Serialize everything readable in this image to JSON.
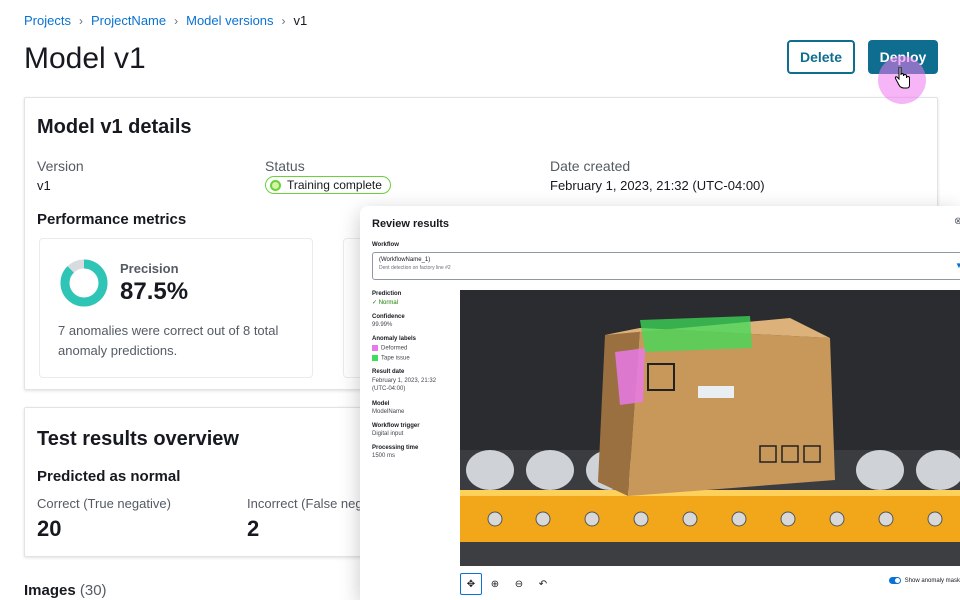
{
  "breadcrumb": [
    "Projects",
    "ProjectName",
    "Model versions",
    "v1"
  ],
  "page_title": "Model v1",
  "actions": {
    "delete_label": "Delete",
    "deploy_label": "Deploy"
  },
  "details": {
    "title": "Model v1 details",
    "version_label": "Version",
    "version_value": "v1",
    "status_label": "Status",
    "status_value": "Training complete",
    "date_label": "Date created",
    "date_value": "February 1, 2023, 21:32 (UTC-04:00)",
    "metrics_title": "Performance metrics",
    "precision_label": "Precision",
    "precision_value": "87.5%",
    "precision_fraction": 0.875,
    "precision_note": "7 anomalies were correct out of 8 total anomaly predictions."
  },
  "test_results": {
    "title": "Test results overview",
    "subtitle": "Predicted as normal",
    "correct_label": "Correct (True negative)",
    "correct_value": "20",
    "incorrect_label": "Incorrect (False neg",
    "incorrect_value": "2"
  },
  "images": {
    "label": "Images",
    "count": "(30)"
  },
  "review": {
    "title": "Review results",
    "close_icon": "close-icon",
    "workflow_label": "Workflow",
    "workflow_value": "(WorkflowName_1)",
    "workflow_desc": "Dent detection on factory line #2",
    "prediction_label": "Prediction",
    "prediction_value": "Normal",
    "confidence_label": "Confidence",
    "confidence_value": "99.99%",
    "anomaly_labels_title": "Anomaly labels",
    "anomaly_labels": [
      {
        "name": "Deformed",
        "color": "#e879e8"
      },
      {
        "name": "Tape issue",
        "color": "#3ddc5a"
      }
    ],
    "result_date_label": "Result date",
    "result_date_value": "February 1, 2023, 21:32 (UTC-04:00)",
    "model_label": "Model",
    "model_value": "ModelName",
    "trigger_label": "Workflow trigger",
    "trigger_value": "Digital input",
    "processing_label": "Processing time",
    "processing_value": "1500 ms",
    "toggle_label": "Show anomaly mask"
  },
  "colors": {
    "accent": "#0f6e8f",
    "link": "#0972d3",
    "success": "#6ad13d",
    "halo": "#ee78ee"
  }
}
